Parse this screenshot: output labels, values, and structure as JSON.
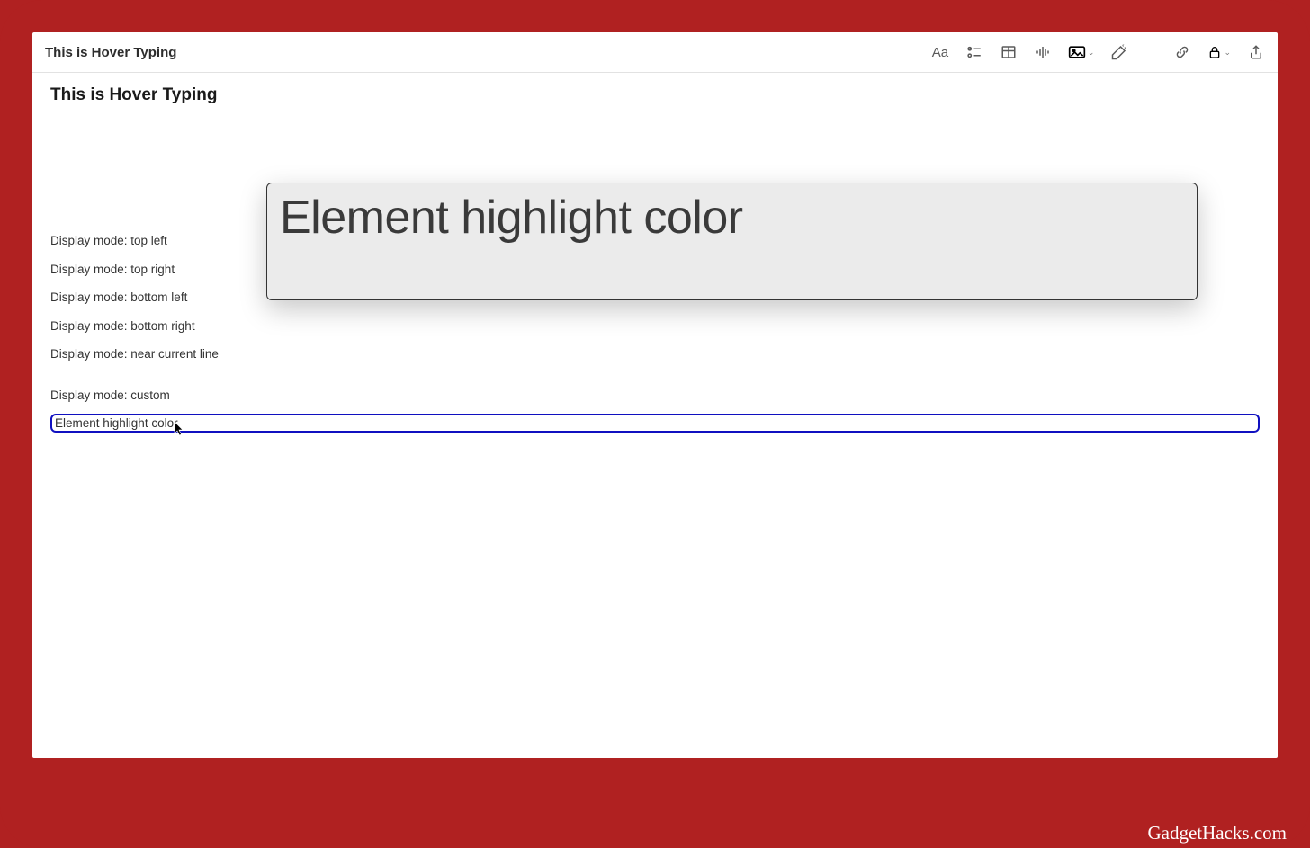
{
  "titlebar": {
    "title": "This is Hover Typing"
  },
  "heading": "This is Hover Typing",
  "hover_panel": {
    "text": "Element highlight color"
  },
  "lines": [
    "Display mode: top left",
    "Display mode: top right",
    "Display mode: bottom left",
    "Display mode: bottom right",
    "Display mode: near current line",
    "Display mode: custom"
  ],
  "highlighted_line": "Element highlight color",
  "watermark": "GadgetHacks.com",
  "toolbar": {
    "font": "Aa",
    "checklist": "checklist",
    "table": "table",
    "audio": "audio",
    "media": "media",
    "magic": "magic",
    "link": "link",
    "lock": "lock",
    "share": "share"
  }
}
